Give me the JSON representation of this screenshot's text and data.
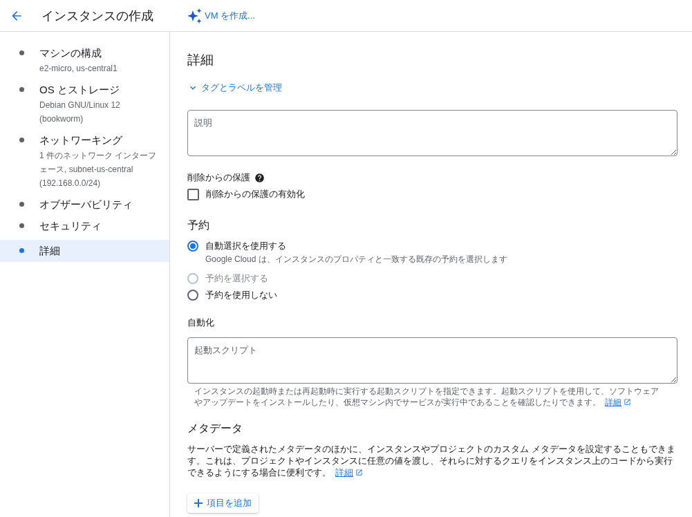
{
  "header": {
    "title": "インスタンスの作成",
    "ai_button": "VM を作成..."
  },
  "steps": [
    {
      "title": "マシンの構成",
      "subtitle": "e2-micro, us-central1",
      "selected": false
    },
    {
      "title": "OS とストレージ",
      "subtitle": "Debian GNU/Linux 12 (bookworm)",
      "selected": false
    },
    {
      "title": "ネットワーキング",
      "subtitle": "1 件のネットワーク インターフェース, subnet-us-central (192.168.0.0/24)",
      "selected": false
    },
    {
      "title": "オブザーバビリティ",
      "selected": false
    },
    {
      "title": "セキュリティ",
      "selected": false
    },
    {
      "title": "詳細",
      "selected": true
    }
  ],
  "details": {
    "heading": "詳細",
    "tags_toggle": {
      "label": "タグとラベルを管理",
      "expanded": false
    },
    "description_field": {
      "placeholder": "説明"
    },
    "deletion_protection": {
      "label": "削除からの保護",
      "checkbox": {
        "label": "削除からの保護の有効化",
        "checked": false
      }
    },
    "reservation": {
      "heading": "予約",
      "options": [
        {
          "label": "自動選択を使用する",
          "hint": "Google Cloud は、インスタンスのプロパティと一致する既存の予約を選択します",
          "selected": true,
          "disabled": false
        },
        {
          "label": "予約を選択する",
          "selected": false,
          "disabled": true
        },
        {
          "label": "予約を使用しない",
          "selected": false,
          "disabled": false
        }
      ]
    },
    "automation": {
      "label": "自動化",
      "startup_script": {
        "placeholder": "起動スクリプト"
      },
      "help": "インスタンスの起動時または再起動時に実行する起動スクリプトを指定できます。起動スクリプトを使用して、ソフトウェアやアップデートをインストールしたり、仮想マシン内でサービスが実行中であることを確認したりできます。",
      "help_link": "詳細"
    },
    "metadata": {
      "heading": "メタデータ",
      "text": "サーバーで定義されたメタデータのほかに、インスタンスやプロジェクトのカスタム メタデータを設定することもできます。これは、プロジェクトやインスタンスに任意の値を渡し、それらに対するクエリをインスタンス上のコードから実行できるようにする場合に便利です。",
      "link": "詳細",
      "add_button": "項目を追加"
    }
  }
}
